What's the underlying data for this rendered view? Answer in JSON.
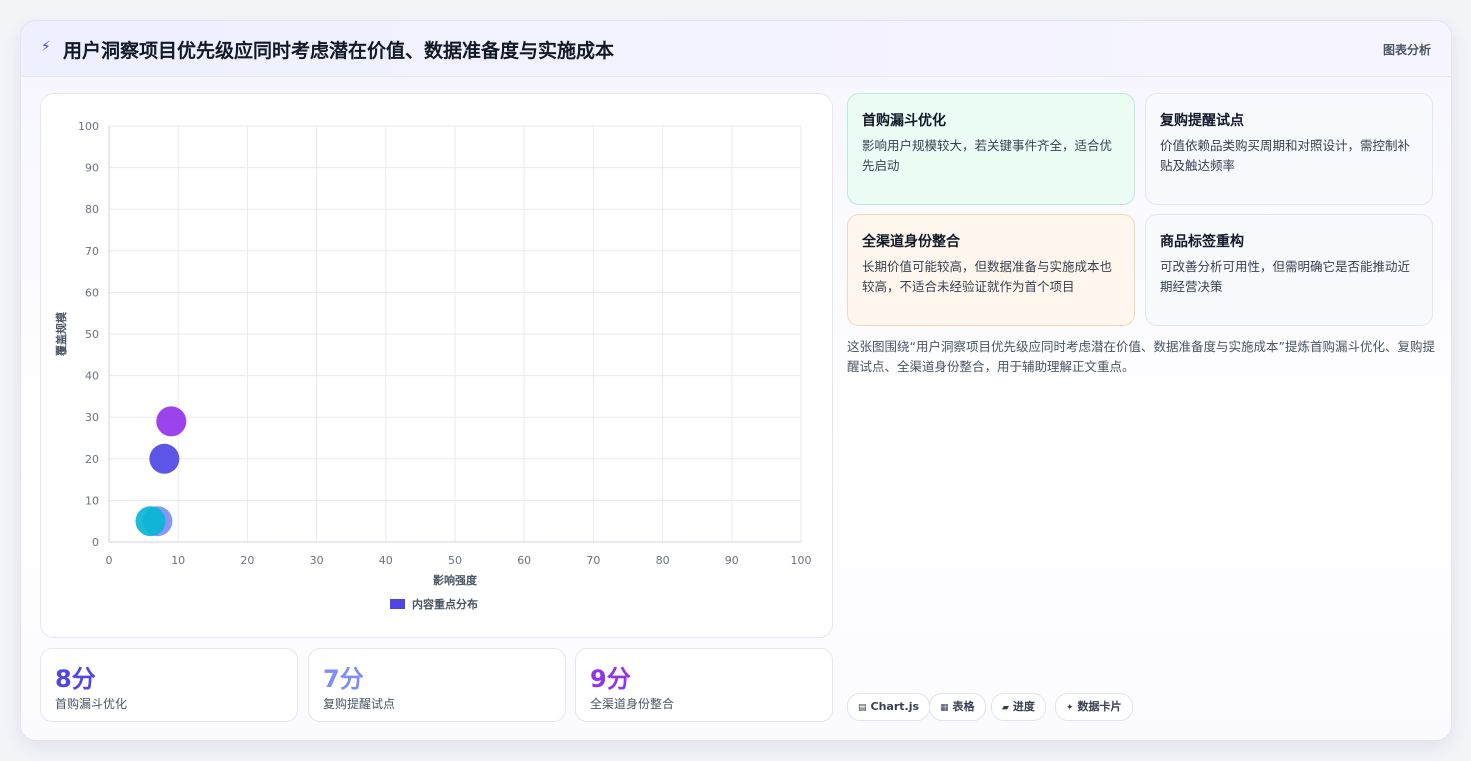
{
  "header": {
    "icon": "bolt-icon",
    "title": "用户洞察项目优先级应同时考虑潜在价值、数据准备度与实施成本",
    "tag": "图表分析"
  },
  "chart_data": {
    "type": "scatter",
    "xlabel": "影响强度",
    "ylabel": "覆盖规模",
    "xlim": [
      0,
      100
    ],
    "ylim": [
      0,
      100
    ],
    "xticks": [
      0,
      10,
      20,
      30,
      40,
      50,
      60,
      70,
      80,
      90,
      100
    ],
    "yticks": [
      0,
      10,
      20,
      30,
      40,
      50,
      60,
      70,
      80,
      90,
      100
    ],
    "grid": true,
    "legend": {
      "position": "bottom",
      "label": "内容重点分布",
      "color": "#4f46e5"
    },
    "points": [
      {
        "x": 9,
        "y": 29,
        "color": "#9333ea"
      },
      {
        "x": 8,
        "y": 20,
        "color": "#4f46e5"
      },
      {
        "x": 7,
        "y": 5,
        "color": "#818cf8"
      },
      {
        "x": 6,
        "y": 5,
        "color": "#06b6d4"
      }
    ]
  },
  "stats": [
    {
      "value": "8分",
      "label": "首购漏斗优化",
      "color": "#4f46e5"
    },
    {
      "value": "7分",
      "label": "复购提醒试点",
      "color": "#818cf8"
    },
    {
      "value": "9分",
      "label": "全渠道身份整合",
      "color": "#9333ea"
    }
  ],
  "cards": [
    {
      "title": "首购漏斗优化",
      "body": "影响用户规模较大，若关键事件齐全，适合优先启动",
      "bg": "#ecfdf5",
      "border": "#bfe9d3"
    },
    {
      "title": "复购提醒试点",
      "body": "价值依赖品类购买周期和对照设计，需控制补贴及触达频率",
      "bg": "#f8f9fd",
      "border": "#e5e7f0"
    },
    {
      "title": "全渠道身份整合",
      "body": "长期价值可能较高，但数据准备与实施成本也较高，不适合未经验证就作为首个项目",
      "bg": "#fff7ed",
      "border": "#f3d9b5"
    },
    {
      "title": "商品标签重构",
      "body": "可改善分析可用性，但需明确它是否能推动近期经营决策",
      "bg": "#f8f9fd",
      "border": "#e5e7f0"
    }
  ],
  "summary": "这张图围绕“用户洞察项目优先级应同时考虑潜在价值、数据准备度与实施成本”提炼首购漏斗优化、复购提醒试点、全渠道身份整合，用于辅助理解正文重点。",
  "chips": [
    {
      "icon": "chart-icon",
      "glyph": "▤",
      "label": "Chart.js"
    },
    {
      "icon": "table-icon",
      "glyph": "▦",
      "label": "表格"
    },
    {
      "icon": "progress-icon",
      "glyph": "▰",
      "label": "进度"
    },
    {
      "icon": "sparkle-icon",
      "glyph": "✦",
      "label": "数据卡片"
    }
  ]
}
